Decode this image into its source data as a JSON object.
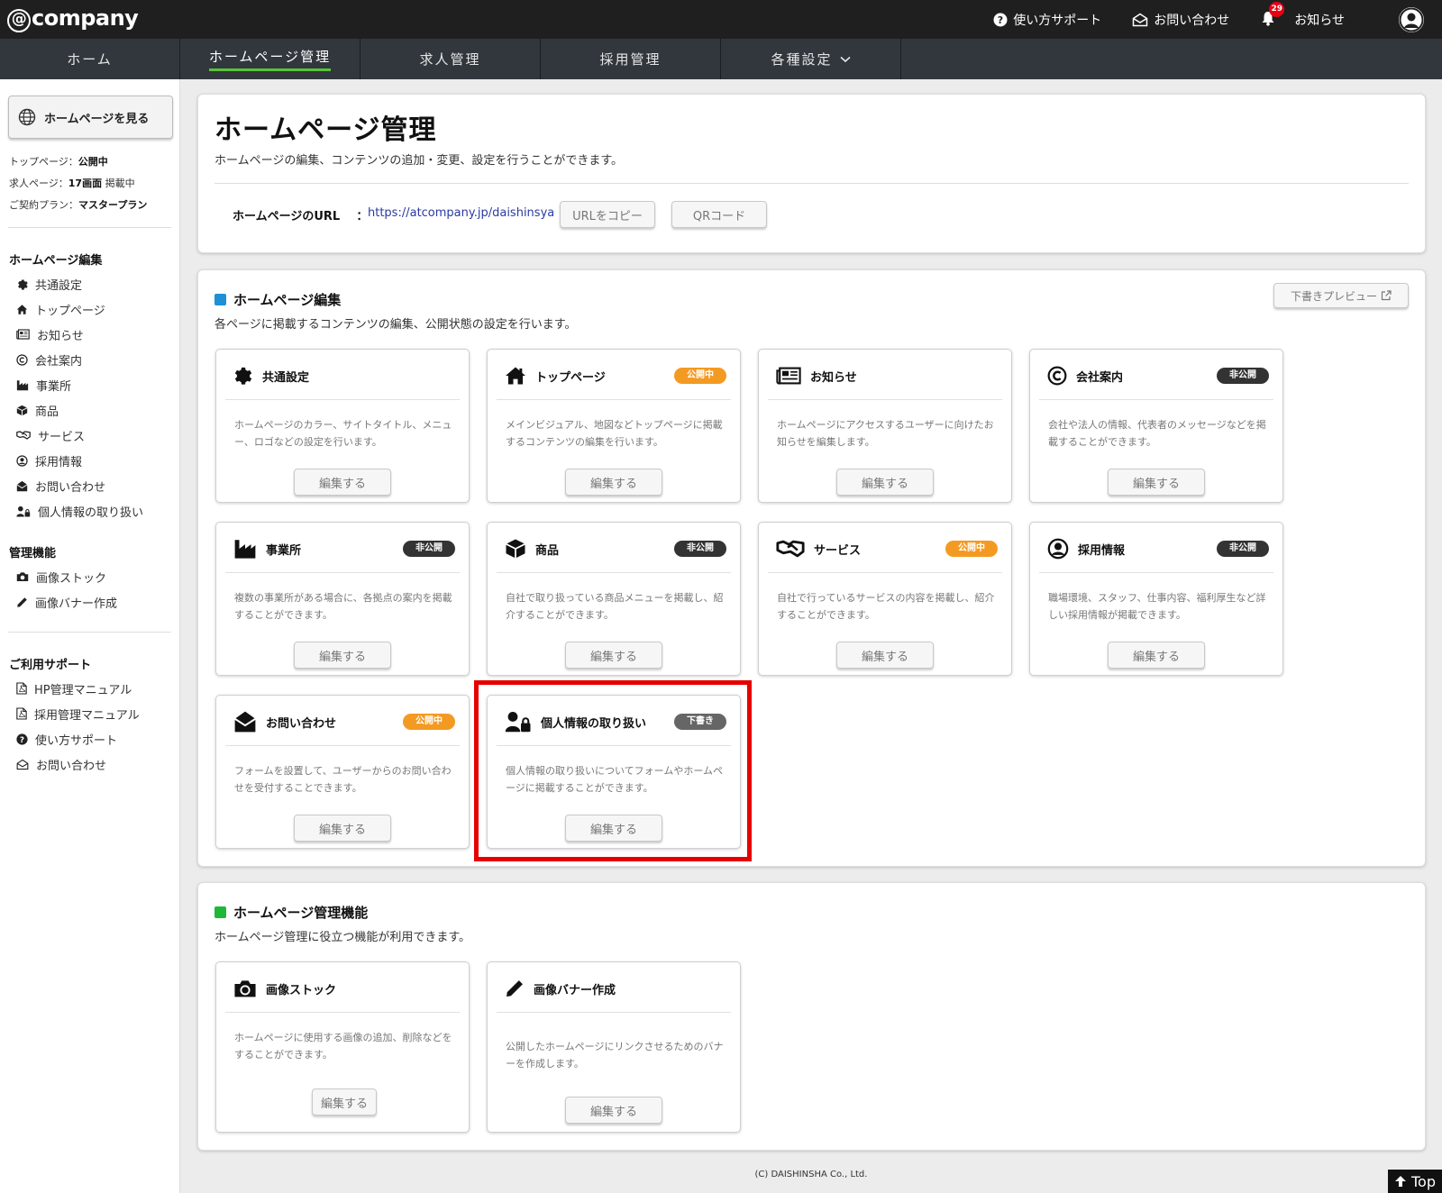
{
  "brand": {
    "logo_at": "@",
    "logo_text": "company"
  },
  "header": {
    "support": "使い方サポート",
    "contact": "お問い合わせ",
    "notice": "お知らせ",
    "notice_count": "29"
  },
  "nav": {
    "tabs": [
      {
        "label": "ホーム"
      },
      {
        "label": "ホームページ管理"
      },
      {
        "label": "求人管理"
      },
      {
        "label": "採用管理"
      },
      {
        "label": "各種設定"
      }
    ]
  },
  "sidebar": {
    "view_site": "ホームページを見る",
    "status": [
      {
        "label": "トップページ：",
        "value": "公開中",
        "suffix": ""
      },
      {
        "label": "求人ページ：",
        "value": "17画面",
        "suffix": " 掲載中"
      },
      {
        "label": "ご契約プラン：",
        "value": "マスタープラン",
        "suffix": ""
      }
    ],
    "edit_heading": "ホームページ編集",
    "edit_items": [
      "共通設定",
      "トップページ",
      "お知らせ",
      "会社案内",
      "事業所",
      "商品",
      "サービス",
      "採用情報",
      "お問い合わせ",
      "個人情報の取り扱い"
    ],
    "tools_heading": "管理機能",
    "tools_items": [
      "画像ストック",
      "画像バナー作成"
    ],
    "support_heading": "ご利用サポート",
    "support_items": [
      "HP管理マニュアル",
      "採用管理マニュアル",
      "使い方サポート",
      "お問い合わせ"
    ]
  },
  "main": {
    "title": "ホームページ管理",
    "description": "ホームページの編集、コンテンツの追加・変更、設定を行うことができます。",
    "url_label": "ホームページのURL",
    "url_colon": "：",
    "url": "https://atcompany.jp/daishinsya",
    "copy_url": "URLをコピー",
    "qr_code": "QRコード"
  },
  "edit_section": {
    "title": "ホームページ編集",
    "description": "各ページに掲載するコンテンツの編集、公開状態の設定を行います。",
    "preview": "下書きプレビュー",
    "edit_label": "編集する",
    "cards": [
      {
        "title": "共通設定",
        "badge": "",
        "desc": "ホームページのカラー、サイトタイトル、メニュー、ロゴなどの設定を行います。"
      },
      {
        "title": "トップページ",
        "badge": "公開中",
        "desc": "メインビジュアル、地図などトップページに掲載するコンテンツの編集を行います。"
      },
      {
        "title": "お知らせ",
        "badge": "",
        "desc": "ホームページにアクセスするユーザーに向けたお知らせを編集します。"
      },
      {
        "title": "会社案内",
        "badge": "非公開",
        "desc": "会社や法人の情報、代表者のメッセージなどを掲載することができます。"
      },
      {
        "title": "事業所",
        "badge": "非公開",
        "desc": "複数の事業所がある場合に、各拠点の案内を掲載することができます。"
      },
      {
        "title": "商品",
        "badge": "非公開",
        "desc": "自社で取り扱っている商品メニューを掲載し、紹介することができます。"
      },
      {
        "title": "サービス",
        "badge": "公開中",
        "desc": "自社で行っているサービスの内容を掲載し、紹介することができます。"
      },
      {
        "title": "採用情報",
        "badge": "非公開",
        "desc": "職場環境、スタッフ、仕事内容、福利厚生など詳しい採用情報が掲載できます。"
      },
      {
        "title": "お問い合わせ",
        "badge": "公開中",
        "desc": "フォームを設置して、ユーザーからのお問い合わせを受付することできます。"
      },
      {
        "title": "個人情報の取り扱い",
        "badge": "下書き",
        "desc": "個人情報の取り扱いについてフォームやホームページに掲載することができます。"
      }
    ]
  },
  "tools_section": {
    "title": "ホームページ管理機能",
    "description": "ホームページ管理に役立つ機能が利用できます。",
    "edit_label": "編集する",
    "cards": [
      {
        "title": "画像ストック",
        "desc": "ホームページに使用する画像の追加、削除などをすることができます。"
      },
      {
        "title": "画像バナー作成",
        "desc": "公開したホームページにリンクさせるためのバナーを作成します。"
      }
    ]
  },
  "footer": {
    "copyright": "(C) DAISHINSHA Co., Ltd.",
    "top": "Top"
  },
  "colors": {
    "accent_green": "#56c43a",
    "edit_blue": "#1e90d6",
    "tools_green": "#1db83a",
    "public_orange": "#f39a22",
    "private_dark": "#333333",
    "highlight_red": "#e60000"
  }
}
